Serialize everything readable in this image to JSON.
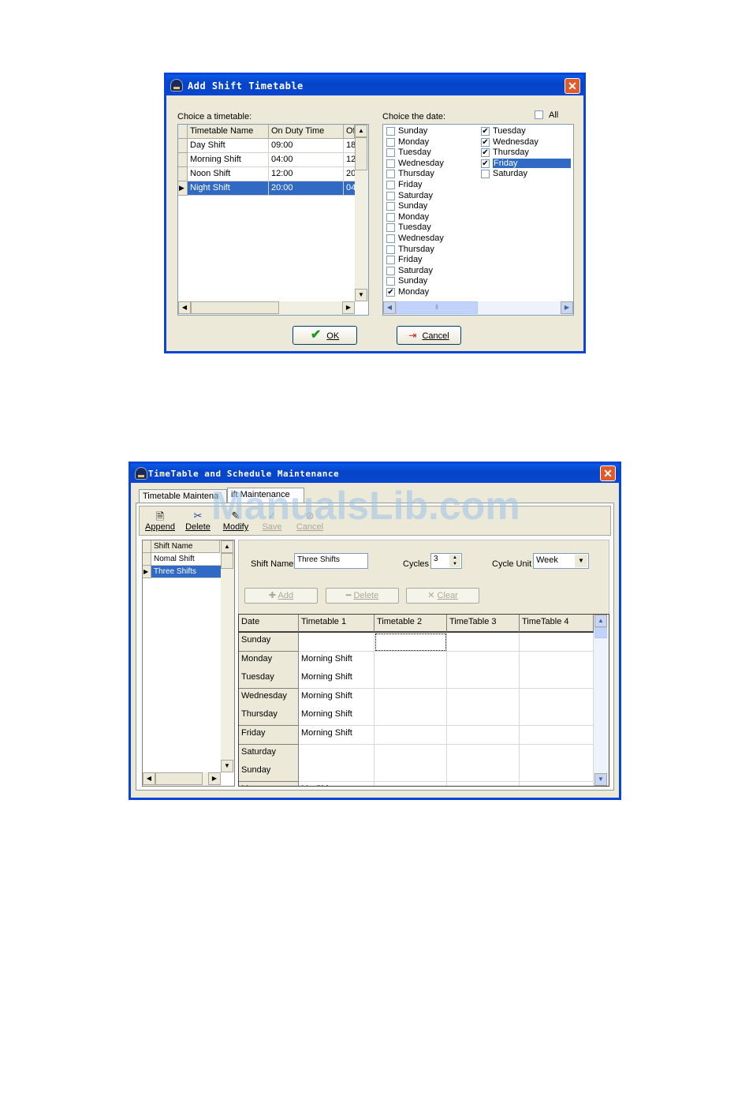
{
  "dialog1": {
    "title": "Add Shift Timetable",
    "close_glyph": "✕",
    "choice_timetable_label": "Choice a timetable:",
    "columns": [
      "Timetable Name",
      "On Duty Time",
      "Of"
    ],
    "rows": [
      {
        "name": "Day Shift",
        "on": "09:00",
        "off": "18"
      },
      {
        "name": "Morning Shift",
        "on": "04:00",
        "off": "12"
      },
      {
        "name": "Noon Shift",
        "on": "12:00",
        "off": "20"
      },
      {
        "name": "Night Shift",
        "on": "20:00",
        "off": "04"
      }
    ],
    "selected_row": 3,
    "choice_date_label": "Choice the date:",
    "all_label": "All",
    "days_col1": [
      {
        "label": "Sunday",
        "checked": false
      },
      {
        "label": "Monday",
        "checked": false
      },
      {
        "label": "Tuesday",
        "checked": false
      },
      {
        "label": "Wednesday",
        "checked": false
      },
      {
        "label": "Thursday",
        "checked": false
      },
      {
        "label": "Friday",
        "checked": false
      },
      {
        "label": "Saturday",
        "checked": false
      },
      {
        "label": "Sunday",
        "checked": false
      },
      {
        "label": "Monday",
        "checked": false
      },
      {
        "label": "Tuesday",
        "checked": false
      },
      {
        "label": "Wednesday",
        "checked": false
      },
      {
        "label": "Thursday",
        "checked": false
      },
      {
        "label": "Friday",
        "checked": false
      },
      {
        "label": "Saturday",
        "checked": false
      },
      {
        "label": "Sunday",
        "checked": false
      },
      {
        "label": "Monday",
        "checked": true
      }
    ],
    "days_col2": [
      {
        "label": "Tuesday",
        "checked": true
      },
      {
        "label": "Wednesday",
        "checked": true
      },
      {
        "label": "Thursday",
        "checked": true
      },
      {
        "label": "Friday",
        "checked": true,
        "selected": true
      },
      {
        "label": "Saturday",
        "checked": false
      }
    ],
    "ok_label": "OK",
    "cancel_label": "Cancel"
  },
  "dialog2": {
    "title": "TimeTable and Schedule Maintenance",
    "close_glyph": "✕",
    "tabs": [
      "Timetable Maintena",
      "ift Maintenance"
    ],
    "toolbar": [
      "Append",
      "Delete",
      "Modify",
      "Save",
      "Cancel"
    ],
    "shift_list_header": "Shift Name",
    "shifts": [
      "Nomal Shift",
      "Three Shifts"
    ],
    "selected_shift": 1,
    "shift_name_label": "Shift Name",
    "shift_name_value": "Three Shifts",
    "cycles_label": "Cycles",
    "cycles_value": "3",
    "cycle_unit_label": "Cycle Unit",
    "cycle_unit_value": "Week",
    "buttons": [
      "Add",
      "Delete",
      "Clear"
    ],
    "grid_headers": [
      "Date",
      "Timetable 1",
      "Timetable 2",
      "TimeTable 3",
      "TimeTable 4"
    ],
    "grid_rows": [
      [
        "Sunday",
        "",
        "",
        "",
        ""
      ],
      [
        "Monday",
        "Morning Shift",
        "",
        "",
        ""
      ],
      [
        "Tuesday",
        "Morning Shift",
        "",
        "",
        ""
      ],
      [
        "Wednesday",
        "Morning Shift",
        "",
        "",
        ""
      ],
      [
        "Thursday",
        "Morning Shift",
        "",
        "",
        ""
      ],
      [
        "Friday",
        "Morning Shift",
        "",
        "",
        ""
      ],
      [
        "Saturday",
        "",
        "",
        "",
        ""
      ],
      [
        "Sunday",
        "",
        "",
        "",
        ""
      ],
      [
        "Mo",
        "Mo  Shi",
        "",
        "",
        ""
      ]
    ]
  },
  "watermark": "ManualsLib.com"
}
